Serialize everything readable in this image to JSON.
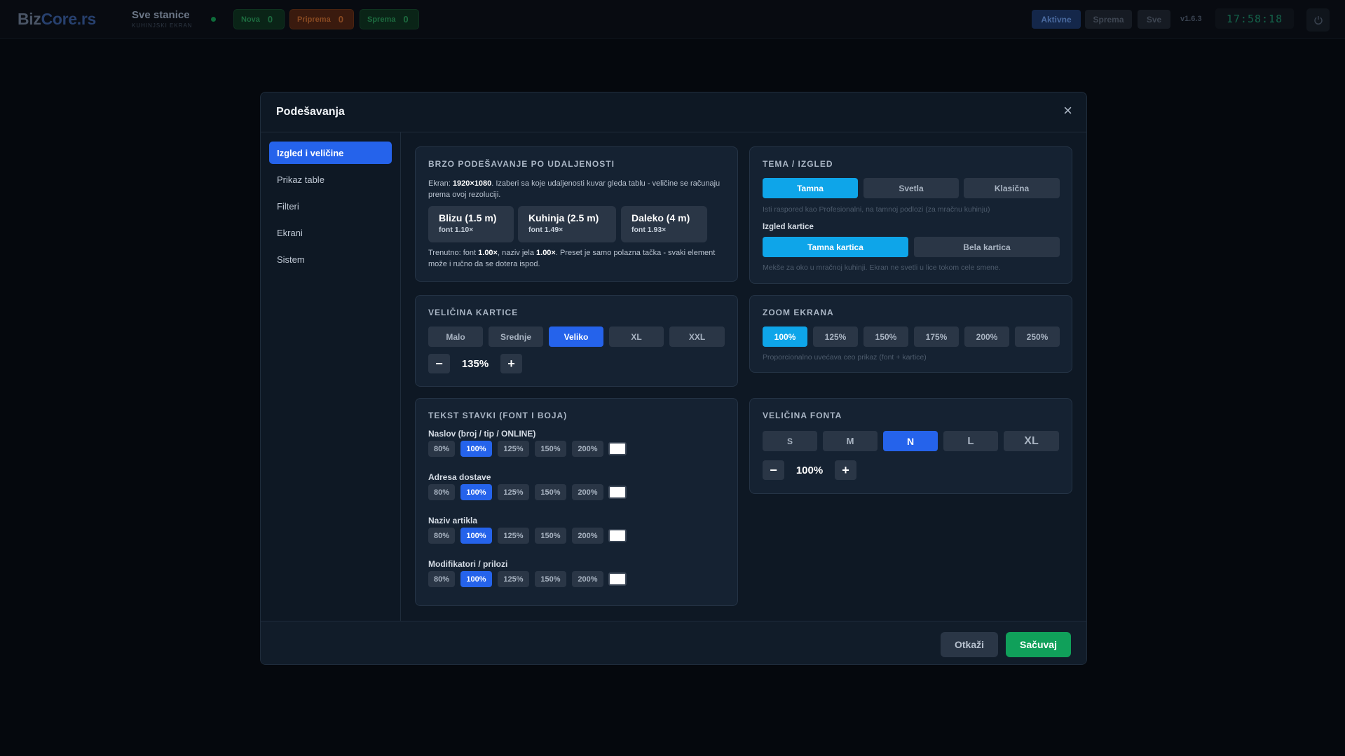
{
  "topbar": {
    "brand_a": "Biz",
    "brand_b": "Core.rs",
    "station_title": "Sve stanice",
    "station_sub": "KUHINJSKI EKRAN",
    "pills": [
      {
        "label": "Nova",
        "count": "0"
      },
      {
        "label": "Priprema",
        "count": "0"
      },
      {
        "label": "Sprema",
        "count": "0"
      }
    ],
    "buttons": {
      "aktivne": "Aktivne",
      "sprema": "Sprema",
      "sve": "Sve"
    },
    "version": "v1.6.3",
    "clock": "17:58:18",
    "power_icon": "power-icon"
  },
  "modal": {
    "title": "Podešavanja",
    "close": "×",
    "sidebar": [
      {
        "label": "Izgled i veličine",
        "active": true
      },
      {
        "label": "Prikaz table"
      },
      {
        "label": "Filteri"
      },
      {
        "label": "Ekrani"
      },
      {
        "label": "Sistem"
      }
    ],
    "distance": {
      "title": "BRZO PODEŠAVANJE PO UDALJENOSTI",
      "desc_a": "Ekran: ",
      "desc_res": "1920×1080",
      "desc_b": ". Izaberi sa koje udaljenosti kuvar gleda tablu - veličine se računaju prema ovoj rezoluciji.",
      "presets": [
        {
          "label": "Blizu (1.5 m)",
          "sub": "font 1.10×"
        },
        {
          "label": "Kuhinja (2.5 m)",
          "sub": "font 1.49×"
        },
        {
          "label": "Daleko (4 m)",
          "sub": "font 1.93×"
        }
      ],
      "current_a": "Trenutno: font ",
      "current_font": "1.00×",
      "current_b": ", naziv jela ",
      "current_name": "1.00×",
      "current_c": ". Preset je samo polazna tačka - svaki element može i ručno da se dotera ispod."
    },
    "theme": {
      "title": "TEMA / IZGLED",
      "options": [
        "Tamna",
        "Svetla",
        "Klasična"
      ],
      "hint": "Isti raspored kao Profesionalni, na tamnoj podlozi (za mračnu kuhinju)",
      "card_label": "Izgled kartice",
      "card_options": [
        "Tamna kartica",
        "Bela kartica"
      ],
      "card_hint": "Mekše za oko u mračnoj kuhinji. Ekran ne svetli u lice tokom cele smene."
    },
    "card_size": {
      "title": "VELIČINA KARTICE",
      "options": [
        "Malo",
        "Srednje",
        "Veliko",
        "XL",
        "XXL"
      ],
      "minus": "−",
      "value": "135%",
      "plus": "+"
    },
    "zoom": {
      "title": "ZOOM EKRANA",
      "options": [
        "100%",
        "125%",
        "150%",
        "175%",
        "200%",
        "250%"
      ],
      "hint": "Proporcionalno uvećava ceo prikaz (font + kartice)"
    },
    "item_text": {
      "title": "TEKST STAVKI (FONT I BOJA)",
      "scales": [
        "80%",
        "100%",
        "125%",
        "150%",
        "200%"
      ],
      "rows": [
        {
          "label": "Naslov (broj / tip / ONLINE)",
          "color": "#ffffff"
        },
        {
          "label": "Adresa dostave",
          "color": "#ffffff"
        },
        {
          "label": "Naziv artikla",
          "color": "#ffffff"
        },
        {
          "label": "Modifikatori / prilozi",
          "color": "#ffffff"
        }
      ]
    },
    "font_size": {
      "title": "VELIČINA FONTA",
      "options": [
        "S",
        "M",
        "N",
        "L",
        "XL"
      ],
      "minus": "−",
      "value": "100%",
      "plus": "+"
    },
    "footer": {
      "cancel": "Otkaži",
      "save": "Sačuvaj"
    }
  }
}
